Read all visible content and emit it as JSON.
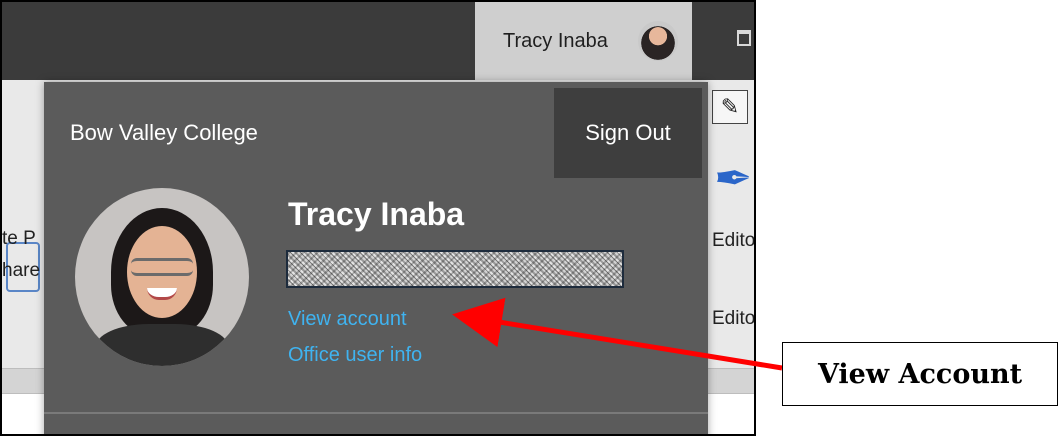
{
  "titlebar": {
    "account_name": "Tracy Inaba",
    "avatar_icon": "avatar-icon",
    "right_icon": "window-restore-icon"
  },
  "ribbon": {
    "left_fragment_1": "te P",
    "left_fragment_2": "hare",
    "right_fragment_1": "Edito",
    "right_fragment_2": "Edito",
    "pencil_icon": "pencil-icon",
    "editor_icon": "editor-icon",
    "share_icon": "share-icon"
  },
  "account_panel": {
    "organization": "Bow Valley College",
    "sign_out_label": "Sign Out",
    "user_name": "Tracy Inaba",
    "view_account_label": "View account",
    "office_user_info_label": "Office user info"
  },
  "annotation": {
    "callout_label": "View Account",
    "arrow_color": "#ff0000"
  },
  "colors": {
    "panel_bg": "#5b5b5b",
    "titlebar_bg": "#3b3b3b",
    "link_color": "#3fb3f0",
    "signout_bg": "#3e3e3e"
  }
}
